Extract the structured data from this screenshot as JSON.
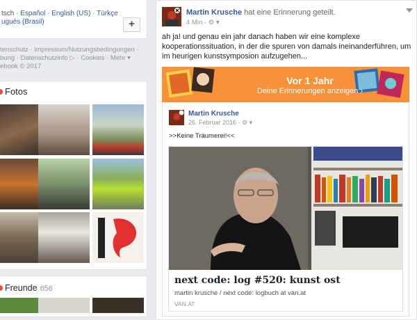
{
  "languages": {
    "line1_a": "tsch",
    "line1_b": "Español",
    "line1_c": "English (US)",
    "line1_d": "Türkçe",
    "line2": "ugués (Brasil)",
    "plus_label": "+"
  },
  "footer": {
    "line1": "tenschutz · Impressum/Nutzungsbedingungen ·",
    "line2": "bung · Datenschutzinfo ▷ · Cookies · Mehr ▾",
    "line3": "ebook © 2017"
  },
  "fotos": {
    "title": "Fotos"
  },
  "freunde": {
    "title": "Freunde",
    "count": "656"
  },
  "post": {
    "author": "Martin Krusche",
    "action": "hat eine Erinnerung geteilt.",
    "time": "4 Min ·",
    "text": "ah ja! und genau ein jahr danach haben wir eine komplexe kooperationssituation, in der die spuren von damals ineinanderführen, um im heurigen kunstsymposion aufzugehen...",
    "memory": {
      "title": "Vor 1 Jahr",
      "subtitle": "Deine Erinnerungen anzeigen ›"
    },
    "shared": {
      "author": "Martin Krusche",
      "date": "26. Februar 2016 ·",
      "text": ">>Keine Träumerei!<<",
      "link": {
        "title": "next code: log #520: kunst ost",
        "description": "martin krusche / next code: logbuch at van.at",
        "domain": "VAN.AT"
      }
    }
  },
  "colors": {
    "accent": "#365899",
    "banner": "#f7923a"
  }
}
